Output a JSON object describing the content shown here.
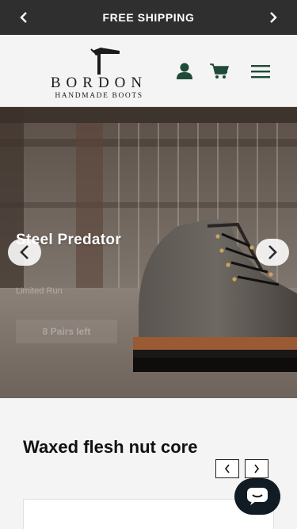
{
  "announcement": {
    "text": "FREE SHIPPING",
    "prev_icon": "chevron-left-icon",
    "next_icon": "chevron-right-icon"
  },
  "header": {
    "brand": "BORDON",
    "tagline": "HANDMADE BOOTS",
    "icons": [
      "user-icon",
      "cart-icon",
      "menu-icon"
    ],
    "accent_color": "#1f4a37"
  },
  "hero": {
    "title": "Steel Predator",
    "subtitle": "Limited Run",
    "button_label": "8 Pairs left",
    "prev_icon": "chevron-left-icon",
    "next_icon": "chevron-right-icon"
  },
  "section": {
    "title": "Waxed flesh nut core",
    "prev_icon": "chevron-left-icon",
    "next_icon": "chevron-right-icon"
  },
  "chat": {
    "icon": "chat-icon",
    "color": "#111b24"
  }
}
